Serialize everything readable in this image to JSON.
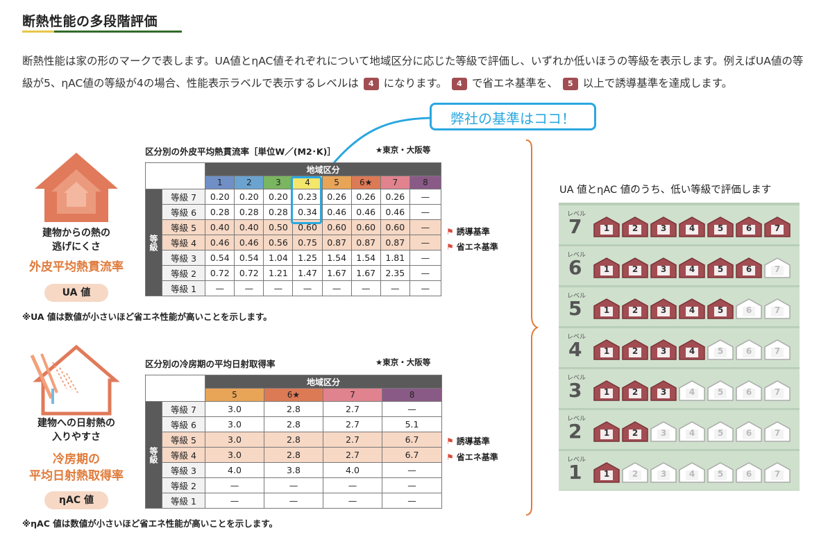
{
  "heading": "断熱性能の多段階評価",
  "paragraph": {
    "p1": "断熱性能は家の形のマークで表します。UA値とηAC値それぞれについて地域区分に応じた等級で評価し、いずれか低いほうの等級を表示します。例えばUA値の等級が5、ηAC値の等級が4の場合、性能表示ラベルで表示するレベルは",
    "b1": "4",
    "p2": "になります。",
    "b2": "4",
    "p3": "で省エネ基準を、",
    "b3": "5",
    "p4": "以上で誘導基準を達成します。"
  },
  "callout": "弊社の基準はココ！",
  "ua": {
    "title": "区分別の外皮平均熱貫流率［単位W／(M2･K)］",
    "note": "★東京・大阪等",
    "region_label": "地域区分",
    "side_label": "等級",
    "regions": [
      "1",
      "2",
      "3",
      "4",
      "5",
      "6★",
      "7",
      "8"
    ],
    "region_colors": [
      "#6f8fc6",
      "#6aa3d0",
      "#7ab560",
      "#f3e66a",
      "#e8a457",
      "#dd7a56",
      "#e0838f",
      "#8a5a86"
    ],
    "rows": [
      {
        "grade": "等級 7",
        "values": [
          "0.20",
          "0.20",
          "0.20",
          "0.23",
          "0.26",
          "0.26",
          "0.26",
          "—"
        ]
      },
      {
        "grade": "等級 6",
        "values": [
          "0.28",
          "0.28",
          "0.28",
          "0.34",
          "0.46",
          "0.46",
          "0.46",
          "—"
        ]
      },
      {
        "grade": "等級 5",
        "values": [
          "0.40",
          "0.40",
          "0.50",
          "0.60",
          "0.60",
          "0.60",
          "0.60",
          "—"
        ]
      },
      {
        "grade": "等級 4",
        "values": [
          "0.46",
          "0.46",
          "0.56",
          "0.75",
          "0.87",
          "0.87",
          "0.87",
          "—"
        ]
      },
      {
        "grade": "等級 3",
        "values": [
          "0.54",
          "0.54",
          "1.04",
          "1.25",
          "1.54",
          "1.54",
          "1.81",
          "—"
        ]
      },
      {
        "grade": "等級 2",
        "values": [
          "0.72",
          "0.72",
          "1.21",
          "1.47",
          "1.67",
          "1.67",
          "2.35",
          "—"
        ]
      },
      {
        "grade": "等級 1",
        "values": [
          "—",
          "—",
          "—",
          "—",
          "—",
          "—",
          "—",
          "—"
        ]
      }
    ],
    "flag_induce": "誘導基準",
    "flag_energy": "省エネ基準",
    "icon_label_1": "建物からの熱の",
    "icon_label_2": "逃げにくさ",
    "icon_orange": "外皮平均熱貫流率",
    "pill": "UA 値",
    "footnote": "※UA 値は数値が小さいほど省エネ性能が高いことを示します。"
  },
  "eta": {
    "title": "区分別の冷房期の平均日射取得率",
    "note": "★東京・大阪等",
    "region_label": "地域区分",
    "side_label": "等級",
    "regions": [
      "5",
      "6★",
      "7",
      "8"
    ],
    "region_colors": [
      "#e8a457",
      "#dd7a56",
      "#e0838f",
      "#8a5a86"
    ],
    "rows": [
      {
        "grade": "等級 7",
        "values": [
          "3.0",
          "2.8",
          "2.7",
          "—"
        ]
      },
      {
        "grade": "等級 6",
        "values": [
          "3.0",
          "2.8",
          "2.7",
          "5.1"
        ]
      },
      {
        "grade": "等級 5",
        "values": [
          "3.0",
          "2.8",
          "2.7",
          "6.7"
        ]
      },
      {
        "grade": "等級 4",
        "values": [
          "3.0",
          "2.8",
          "2.7",
          "6.7"
        ]
      },
      {
        "grade": "等級 3",
        "values": [
          "4.0",
          "3.8",
          "4.0",
          "—"
        ]
      },
      {
        "grade": "等級 2",
        "values": [
          "—",
          "—",
          "—",
          "—"
        ]
      },
      {
        "grade": "等級 1",
        "values": [
          "—",
          "—",
          "—",
          "—"
        ]
      }
    ],
    "flag_induce": "誘導基準",
    "flag_energy": "省エネ基準",
    "icon_label_1": "建物への日射熱の",
    "icon_label_2": "入りやすさ",
    "icon_orange_1": "冷房期の",
    "icon_orange_2": "平均日射熱取得率",
    "pill": "ηAC 値",
    "footnote": "※ηAC 値は数値が小さいほど省エネ性能が高いことを示します。"
  },
  "levels": {
    "title": "UA 値とηAC 値のうち、低い等級で評価します",
    "level_word": "レベル",
    "rows": [
      {
        "level": "7",
        "active": 7
      },
      {
        "level": "6",
        "active": 6
      },
      {
        "level": "5",
        "active": 5
      },
      {
        "level": "4",
        "active": 4
      },
      {
        "level": "3",
        "active": 3
      },
      {
        "level": "2",
        "active": 2
      },
      {
        "level": "1",
        "active": 1
      }
    ],
    "house_numbers": [
      "1",
      "2",
      "3",
      "4",
      "5",
      "6",
      "7"
    ],
    "active_color": "#a14d52",
    "inactive_color": "#ffffff"
  }
}
